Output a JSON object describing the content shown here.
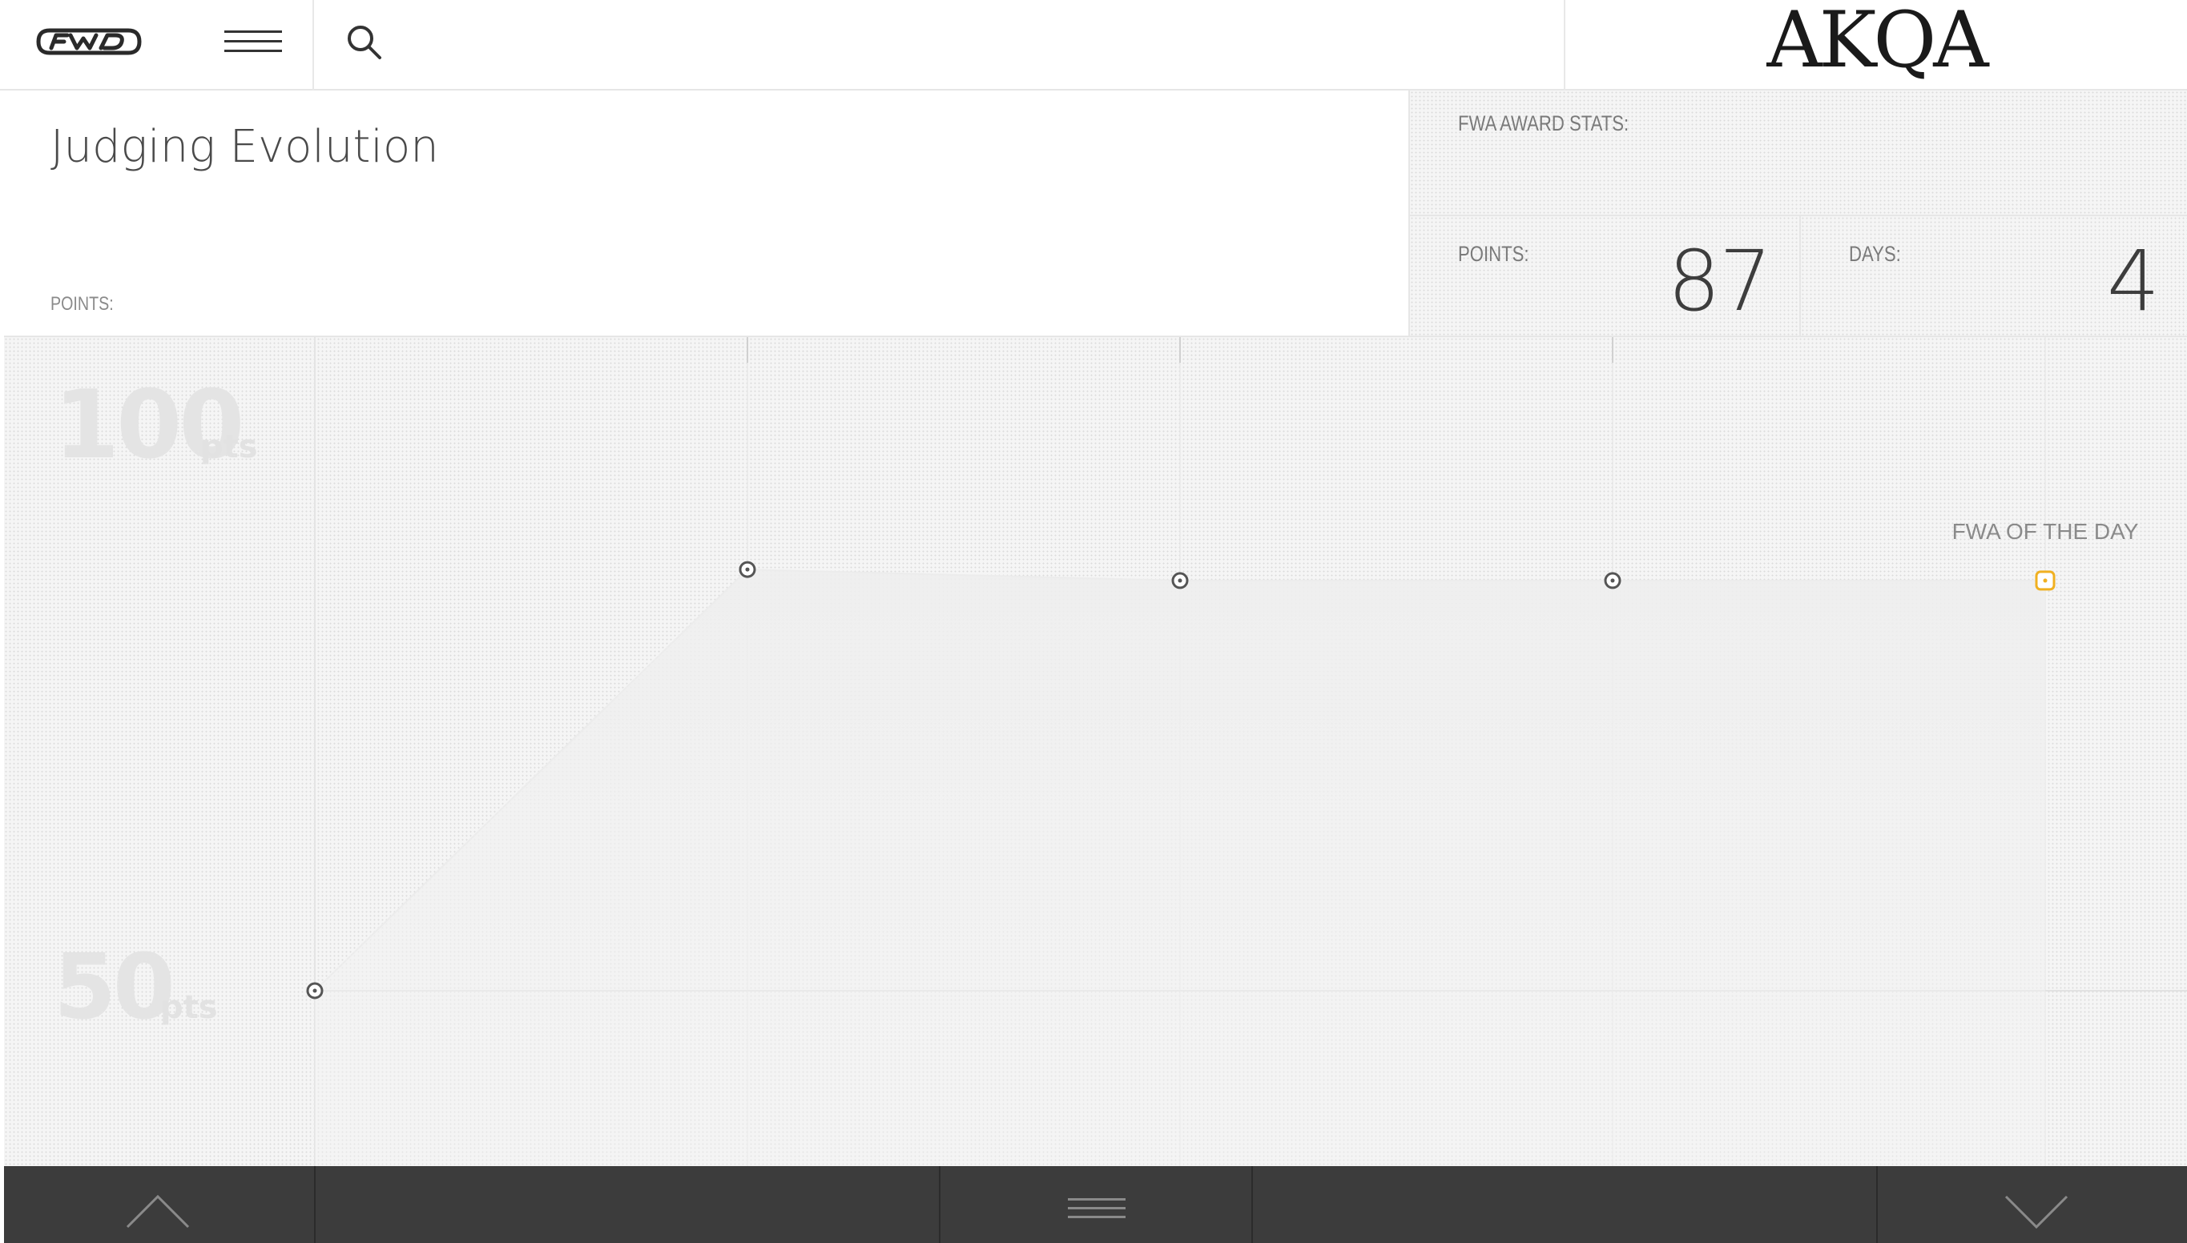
{
  "brand": {
    "site_logo": "fwa",
    "sponsor_logo": "AKQA"
  },
  "header": {
    "title": "Judging Evolution",
    "points_label": "POINTS:"
  },
  "stats": {
    "heading": "FWA AWARD STATS:",
    "points_label": "POINTS:",
    "points_value": "87",
    "days_label": "DAYS:",
    "days_value": "4"
  },
  "chart_data": {
    "type": "line",
    "y_axis": {
      "ticks": [
        {
          "value": "100",
          "unit": "pts"
        },
        {
          "value": "50",
          "unit": "pts"
        }
      ],
      "ylim": [
        50,
        100
      ]
    },
    "points": [
      {
        "day": 0,
        "value": 50
      },
      {
        "day": 1,
        "value": 88
      },
      {
        "day": 2,
        "value": 87
      },
      {
        "day": 3,
        "value": 87
      },
      {
        "day": 4,
        "value": 87
      }
    ],
    "annotation": {
      "day": 4,
      "label": "FWA OF THE DAY"
    },
    "colors": {
      "marker": "#555555",
      "highlight": "#f0b020",
      "fill": "#e9e9e9"
    }
  },
  "icons": {
    "menu": "hamburger-icon",
    "search": "search-icon",
    "up": "chevron-up-icon",
    "down": "chevron-down-icon"
  }
}
